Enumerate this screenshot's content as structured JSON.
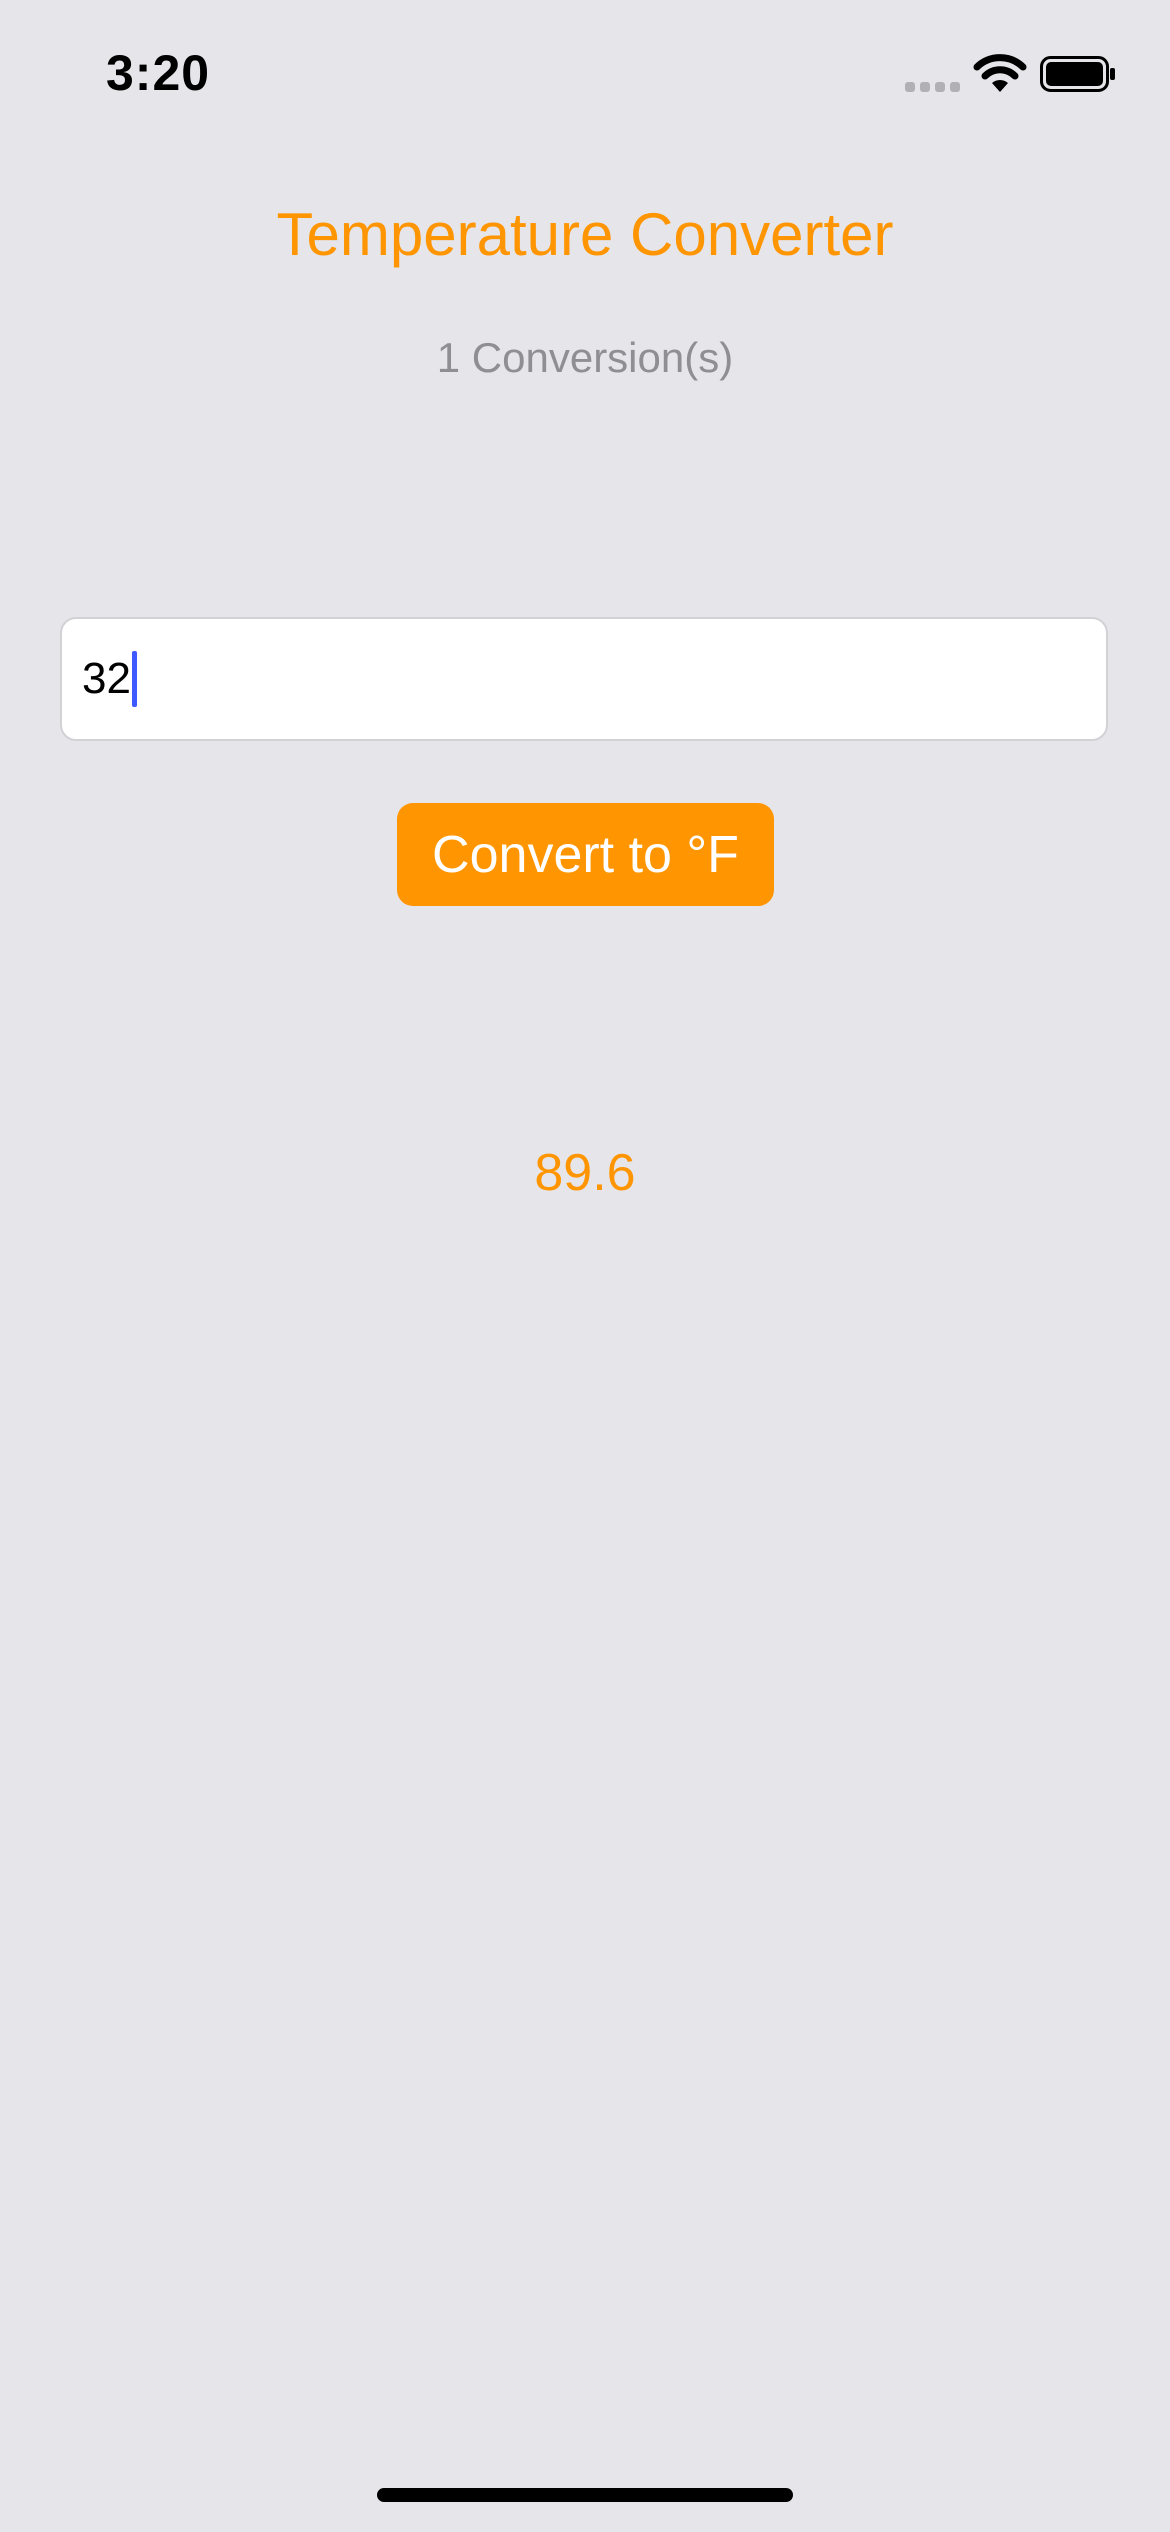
{
  "status_bar": {
    "time": "3:20",
    "icons": [
      "signal-icon",
      "wifi-icon",
      "battery-icon"
    ]
  },
  "app": {
    "title": "Temperature Converter",
    "conversion_count": "1 Conversion(s)",
    "input": {
      "value": "32",
      "placeholder": ""
    },
    "convert_button_label": "Convert to °F",
    "result": "89.6"
  },
  "colors": {
    "accent": "#ff9500",
    "background": "#e5e5ea",
    "secondary_text": "#8e8e93",
    "caret": "#3d5afe"
  }
}
